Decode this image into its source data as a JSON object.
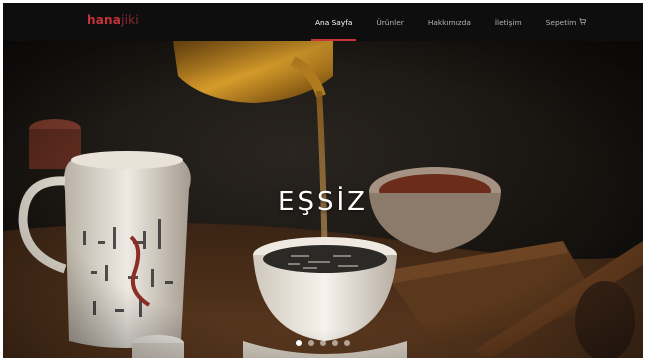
{
  "brand": {
    "part1": "hana",
    "part2": "jiki"
  },
  "nav": {
    "items": [
      {
        "label": "Ana Sayfa",
        "active": true
      },
      {
        "label": "Ürünler",
        "active": false
      },
      {
        "label": "Hakkımızda",
        "active": false
      },
      {
        "label": "İletişim",
        "active": false
      },
      {
        "label": "Sepetim",
        "active": false
      }
    ],
    "cart_icon": "shopping-cart-icon"
  },
  "hero": {
    "title": "EŞSİZ",
    "slide_count": 5,
    "active_slide": 1
  },
  "colors": {
    "brand_accent": "#c8323a",
    "navbar_bg": "#0f0e0e",
    "nav_text": "#b7b2ad",
    "hero_dark": "#151311"
  }
}
